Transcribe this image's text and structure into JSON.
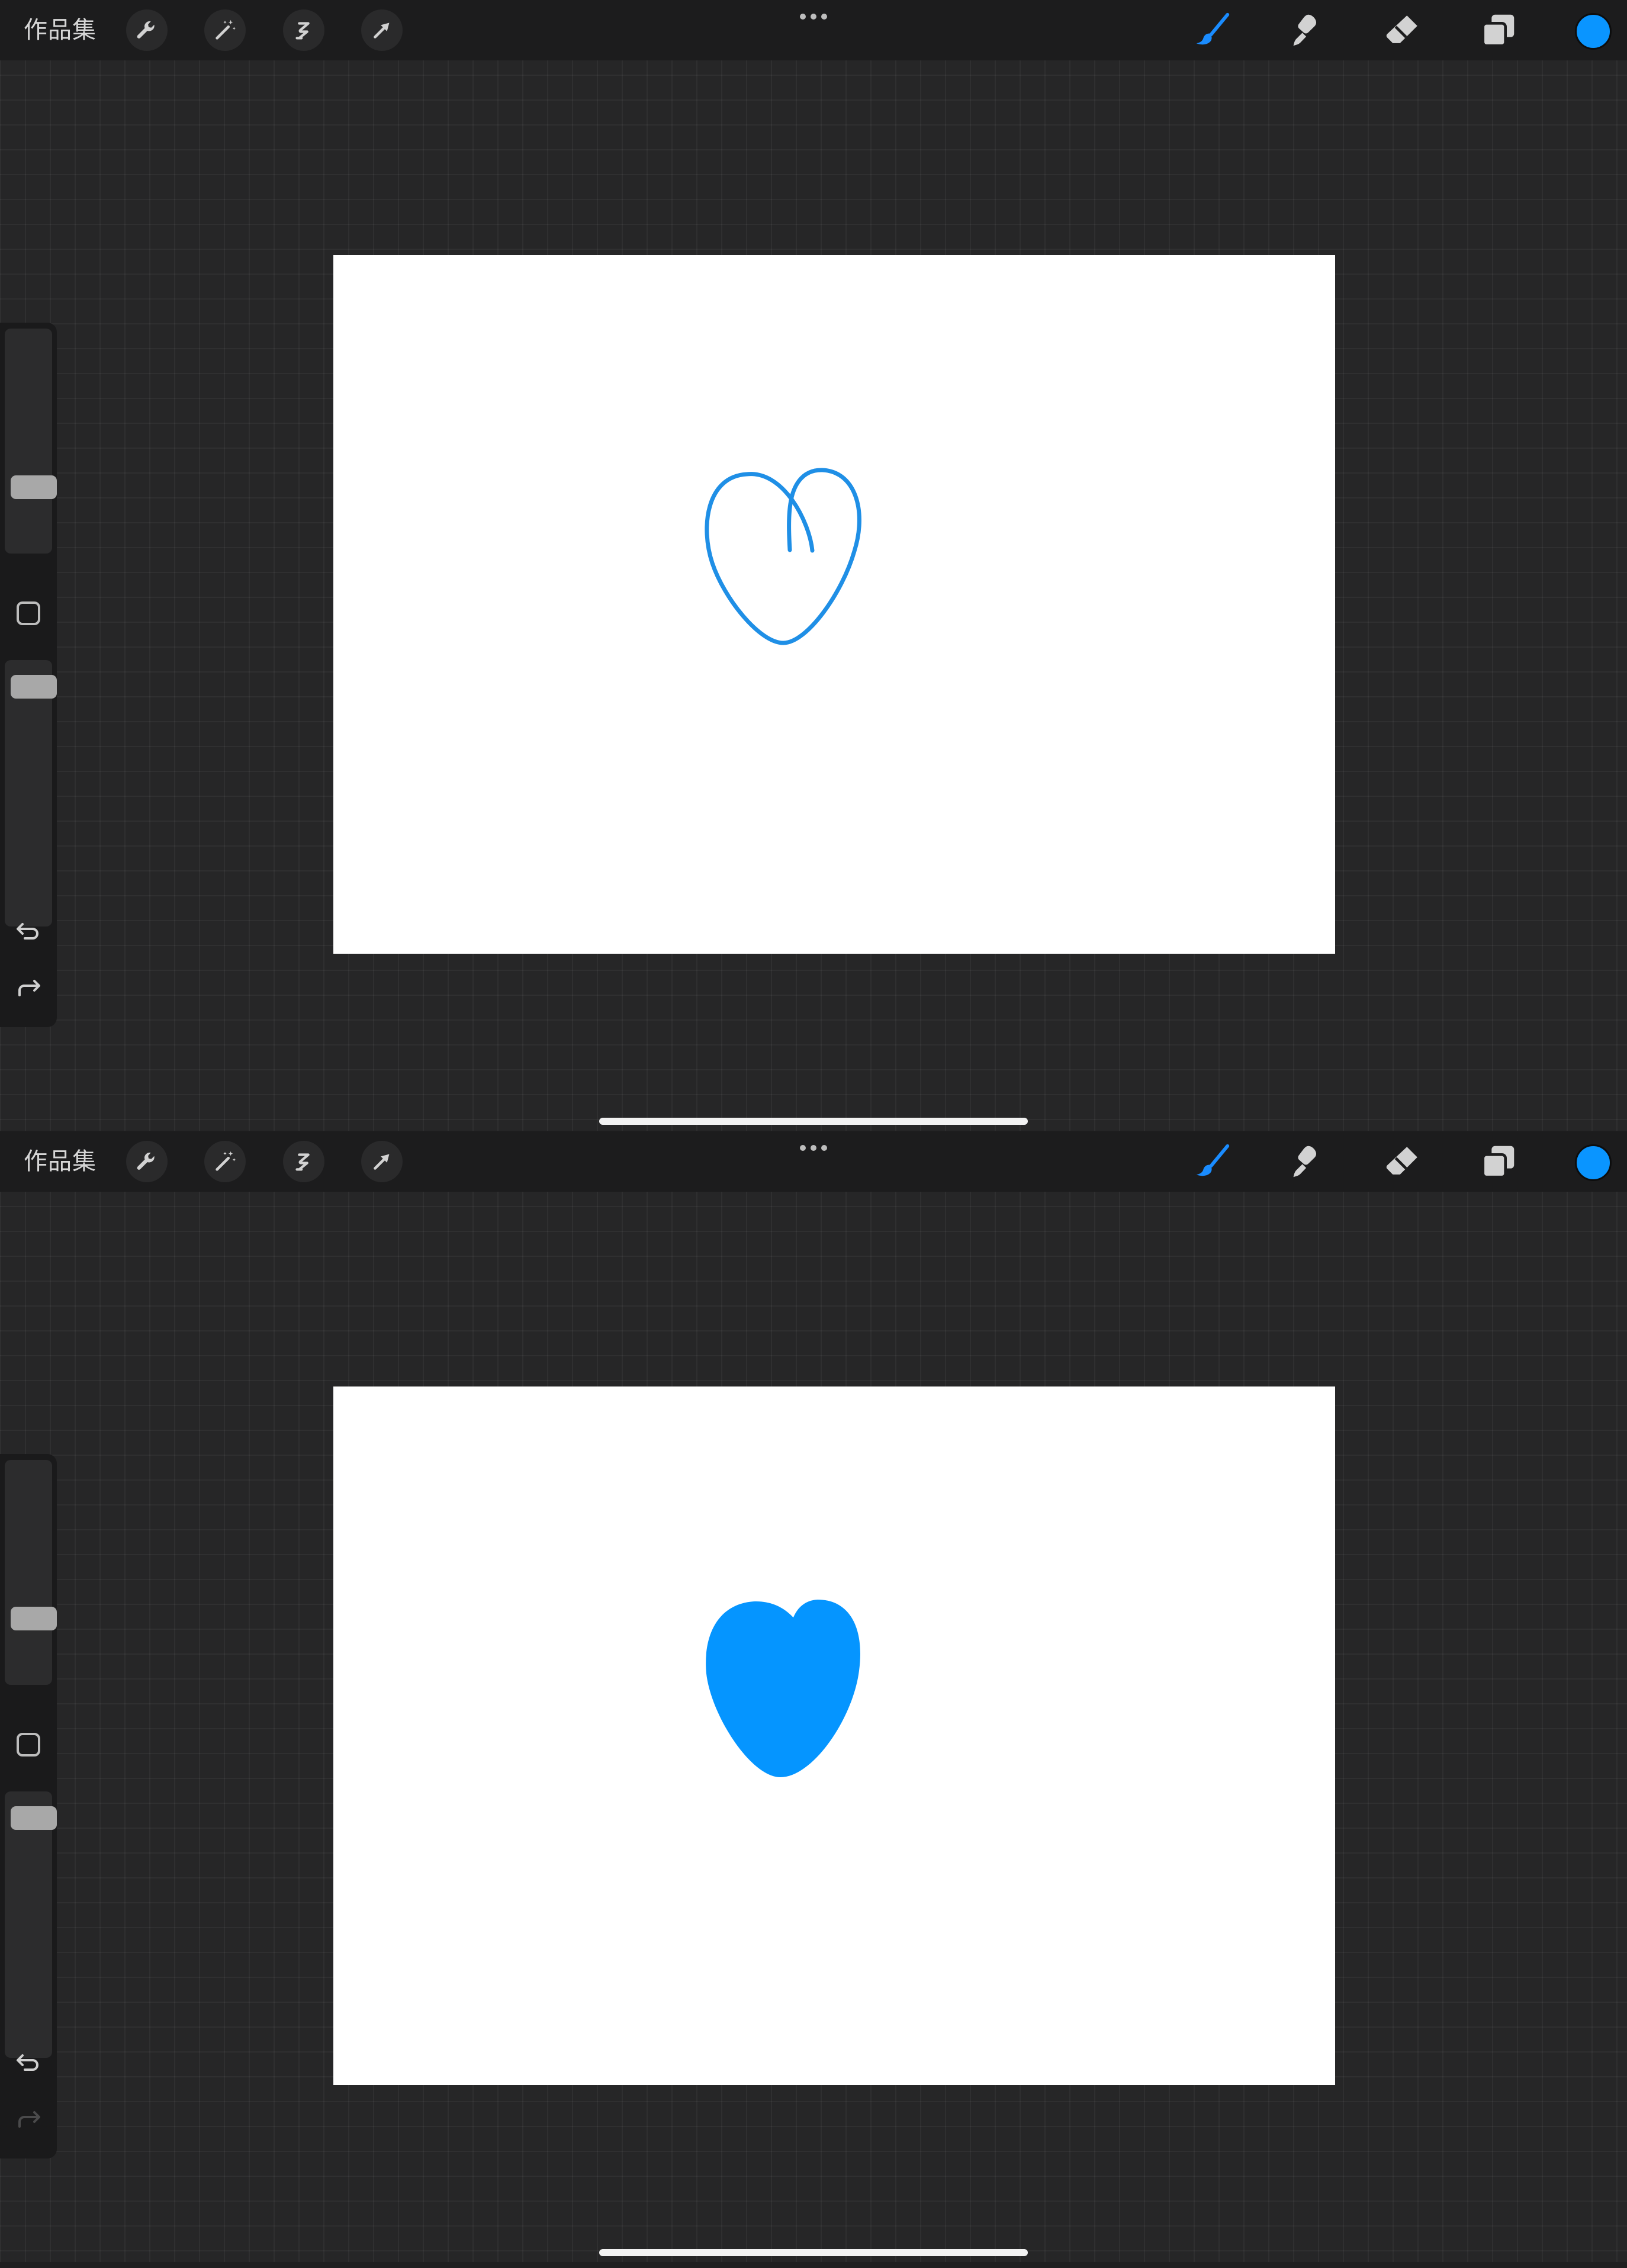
{
  "colors": {
    "accent": "#1a8cff",
    "current_color": "#0a95ff",
    "stroke": "#1f8fe6",
    "fill": "#0595ff"
  },
  "panels": [
    {
      "topbar": {
        "gallery_label": "作品集",
        "tools_left": [
          "wrench-icon",
          "magic-wand-icon",
          "selection-s-icon",
          "arrow-transform-icon"
        ],
        "tools_right": [
          "brush-icon",
          "smudge-icon",
          "eraser-icon",
          "layers-icon"
        ],
        "active_tool": "brush"
      },
      "canvas": {
        "drawing": "heart-outline"
      },
      "sidebar": {
        "size_slider_level": 0.73,
        "opacity_slider_level": 0.06,
        "redo_enabled": true
      }
    },
    {
      "topbar": {
        "gallery_label": "作品集",
        "tools_left": [
          "wrench-icon",
          "magic-wand-icon",
          "selection-s-icon",
          "arrow-transform-icon"
        ],
        "tools_right": [
          "brush-icon",
          "smudge-icon",
          "eraser-icon",
          "layers-icon"
        ],
        "active_tool": "brush"
      },
      "canvas": {
        "drawing": "heart-filled"
      },
      "sidebar": {
        "size_slider_level": 0.73,
        "opacity_slider_level": 0.06,
        "redo_enabled": false
      }
    }
  ]
}
